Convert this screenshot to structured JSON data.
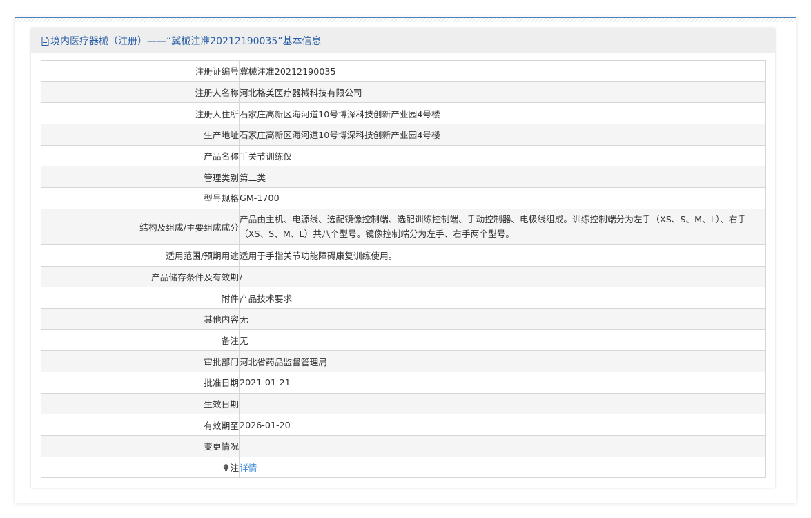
{
  "header": {
    "icon": "document-icon",
    "title": "境内医疗器械（注册）——“冀械注准20212190035”基本信息"
  },
  "rows": [
    {
      "label": "注册证编号",
      "value": "冀械注准20212190035"
    },
    {
      "label": "注册人名称",
      "value": "河北格美医疗器械科技有限公司"
    },
    {
      "label": "注册人住所",
      "value": "石家庄高新区海河道10号博深科技创新产业园4号楼"
    },
    {
      "label": "生产地址",
      "value": "石家庄高新区海河道10号博深科技创新产业园4号楼"
    },
    {
      "label": "产品名称",
      "value": "手关节训练仪"
    },
    {
      "label": "管理类别",
      "value": "第二类"
    },
    {
      "label": "型号规格",
      "value": "GM-1700"
    },
    {
      "label": "结构及组成/主要组成成分",
      "value": "产品由主机、电源线、选配镜像控制端、选配训练控制端、手动控制器、电极线组成。训练控制端分为左手（XS、S、M、L）、右手（XS、S、M、L）共八个型号。镜像控制端分为左手、右手两个型号。"
    },
    {
      "label": "适用范围/预期用途",
      "value": "适用于手指关节功能障碍康复训练使用。"
    },
    {
      "label": "产品储存条件及有效期",
      "value": "/"
    },
    {
      "label": "附件",
      "value": "产品技术要求"
    },
    {
      "label": "其他内容",
      "value": "无"
    },
    {
      "label": "备注",
      "value": "无"
    },
    {
      "label": "审批部门",
      "value": "河北省药品监督管理局"
    },
    {
      "label": "批准日期",
      "value": "2021-01-21"
    },
    {
      "label": "生效日期",
      "value": ""
    },
    {
      "label": "有效期至",
      "value": "2026-01-20"
    },
    {
      "label": "变更情况",
      "value": ""
    }
  ],
  "note": {
    "icon": "lightbulb-icon",
    "label": "注",
    "link": "详情"
  },
  "colors": {
    "accent": "#2b5fa6",
    "link": "#3b87d6",
    "rule": "#4a82c0",
    "alt_row": "#f5f5f5",
    "border": "#d6d6d6",
    "header_bg": "#eeeeee"
  }
}
